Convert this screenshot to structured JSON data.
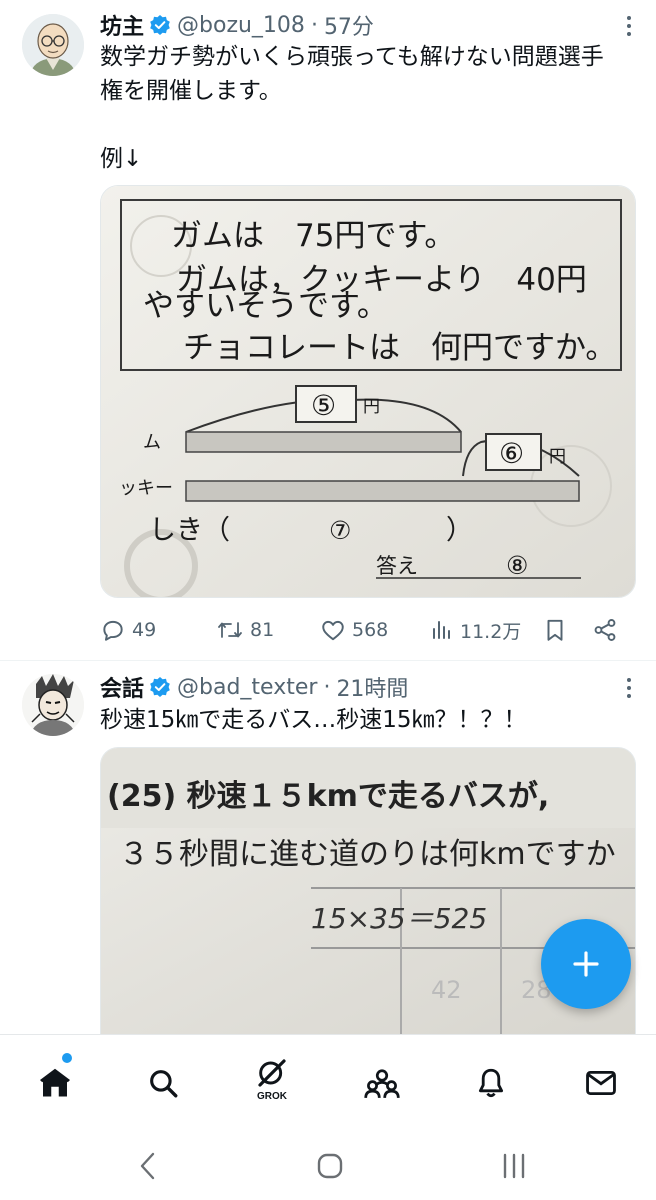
{
  "tweets": [
    {
      "name": "坊主",
      "handle": "@bozu_108",
      "separator": "·",
      "time": "57分",
      "text_line1": "数学ガチ勢がいくら頑張っても解けない問題選手",
      "text_line2": "権を開催します。",
      "text_example": "例↓",
      "image": {
        "line1": "ガムは　75円です。",
        "line2": "ガムは，クッキーより　40円",
        "line3": "やすいそうです。",
        "line4": "チョコレートは　何円ですか。",
        "circle5": "⑤",
        "circle6": "⑥",
        "circle7": "⑦",
        "circle8": "⑧",
        "yen": "円",
        "gum_label": "ム",
        "cookie_label": "ッキー",
        "shiki": "しき（",
        "shiki_close": "）",
        "answer": "答え"
      },
      "actions": {
        "replies": "49",
        "retweets": "81",
        "likes": "568",
        "views": "11.2万"
      }
    },
    {
      "name": "会話",
      "handle": "@bad_texter",
      "separator": "·",
      "time": "21時間",
      "text": "秒速15㎞で走るバス…秒速15㎞？！？！",
      "image": {
        "line1": "(25) 秒速１５kmで走るバスが,",
        "line2": "３５秒間に進む道のりは何kmですか",
        "handwriting": "15×35＝525"
      }
    }
  ],
  "nav": {
    "grok_label": "GROK"
  },
  "colors": {
    "accent": "#1d9bf0",
    "text": "#0f1419",
    "secondary": "#536471"
  }
}
